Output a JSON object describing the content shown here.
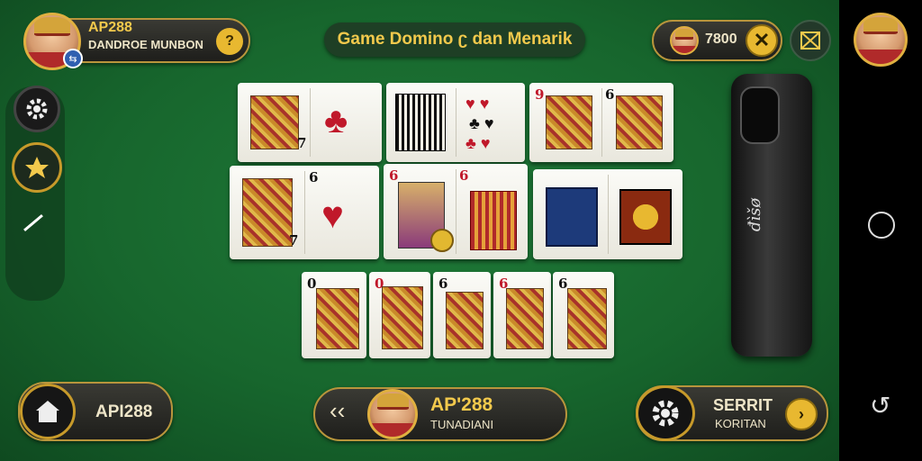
{
  "top_left": {
    "name": "AP288",
    "subtitle": "DANDROE MUNBON"
  },
  "title": "Game Domino ʗ dan Menarik",
  "coins": {
    "value": "7800"
  },
  "bottom_left": {
    "label": "API288"
  },
  "bottom_center": {
    "name": "AP'288",
    "subtitle": "TUNADIANI"
  },
  "bottom_right": {
    "line1": "SERRIT",
    "line2": "KORITAN"
  },
  "shoe_text": "đìšø",
  "icons": [
    "settings-icon",
    "star-icon",
    "line-icon",
    "home-icon",
    "back-arrow-icon",
    "gear-icon",
    "coin-icon",
    "close-box-icon",
    "nav-circle-icon",
    "nav-back-icon",
    "tropy-icon"
  ],
  "colors": {
    "felt": "#1a6e30",
    "gold": "#f2c94c",
    "accent_red": "#c0182a"
  }
}
